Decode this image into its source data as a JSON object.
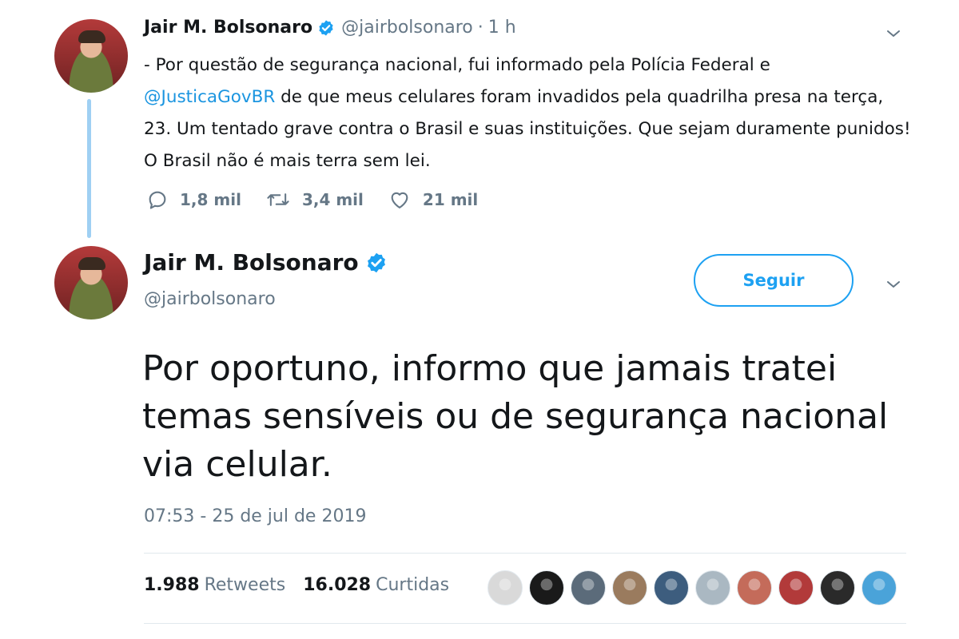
{
  "tweet1": {
    "name": "Jair M. Bolsonaro",
    "handle": "@jairbolsonaro",
    "separator": "·",
    "time": "1 h",
    "text_before_mention": "- Por questão de segurança nacional, fui informado pela Polícia Federal e",
    "mention": "@JusticaGovBR",
    "text_after_mention": " de que meus celulares foram invadidos pela quadrilha presa na terça, 23. Um tentado grave contra o Brasil e suas instituições. Que sejam duramente punidos! O Brasil não é mais terra sem lei.",
    "replies": "1,8 mil",
    "retweets": "3,4 mil",
    "likes": "21 mil"
  },
  "tweet2": {
    "name": "Jair M. Bolsonaro",
    "handle": "@jairbolsonaro",
    "follow_label": "Seguir",
    "text": "Por oportuno, informo que jamais tratei temas sensíveis ou de segurança nacional via celular.",
    "timestamp": "07:53 - 25 de jul de 2019",
    "retweet_count": "1.988",
    "retweet_label": "Retweets",
    "like_count": "16.028",
    "like_label": "Curtidas"
  },
  "likers": [
    {
      "color": "#d9d9d9"
    },
    {
      "color": "#1a1a1a"
    },
    {
      "color": "#5b6b7a"
    },
    {
      "color": "#9a7b5e"
    },
    {
      "color": "#3d5d7e"
    },
    {
      "color": "#aab8c2"
    },
    {
      "color": "#c46b5a"
    },
    {
      "color": "#b23a3a"
    },
    {
      "color": "#2a2a2a"
    },
    {
      "color": "#4aa3d9"
    }
  ],
  "icons": {
    "verified": "verified-badge-icon",
    "caret": "chevron-down-icon",
    "reply": "reply-icon",
    "retweet": "retweet-icon",
    "like": "heart-icon"
  },
  "colors": {
    "accent": "#1da1f2",
    "link": "#1b95e0",
    "muted": "#657786",
    "thread_line": "#9fd0f3"
  }
}
